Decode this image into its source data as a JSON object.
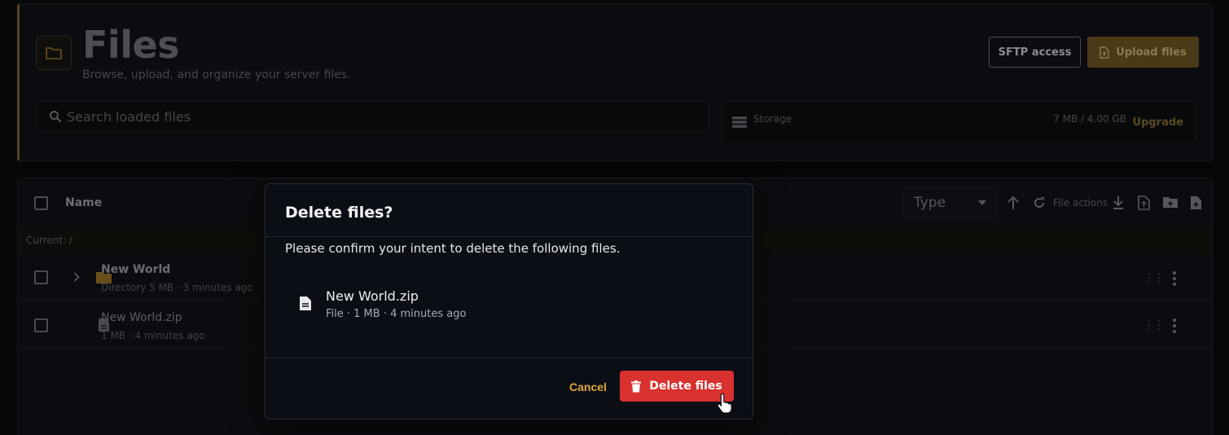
{
  "header": {
    "title": "Files",
    "subtitle": "Browse, upload, and organize your server files.",
    "sftp_label": "SFTP access",
    "upload_label": "Upload files"
  },
  "search": {
    "placeholder": "Search loaded files"
  },
  "storage": {
    "label": "Storage",
    "dot": "·",
    "value": "7 MB / 4.00 GB",
    "upgrade_label": "Upgrade"
  },
  "list": {
    "column_name": "Name",
    "type_select": "Type",
    "file_actions_label": "File actions",
    "current_path": "Current: /",
    "rows": [
      {
        "name": "New World",
        "meta": "Directory 5 MB · 3 minutes ago"
      },
      {
        "name": "New World.zip",
        "meta": "1 MB · 4 minutes ago"
      }
    ]
  },
  "modal": {
    "title": "Delete files?",
    "description": "Please confirm your intent to delete the following files.",
    "file_name": "New World.zip",
    "file_meta": "File · 1 MB · 4 minutes ago",
    "cancel_label": "Cancel",
    "delete_label": "Delete files"
  },
  "colors": {
    "accent": "#e0a83a",
    "danger": "#d9312f",
    "modal_bg": "#0b0e14"
  },
  "icons": [
    "folder-icon",
    "upload-file-icon",
    "search-icon",
    "storage-icon",
    "arrow-up-icon",
    "refresh-icon",
    "download-icon",
    "file-upload-icon",
    "new-folder-icon",
    "new-file-icon",
    "chevron-right-icon",
    "file-icon",
    "trash-icon",
    "pointer-cursor-icon"
  ]
}
